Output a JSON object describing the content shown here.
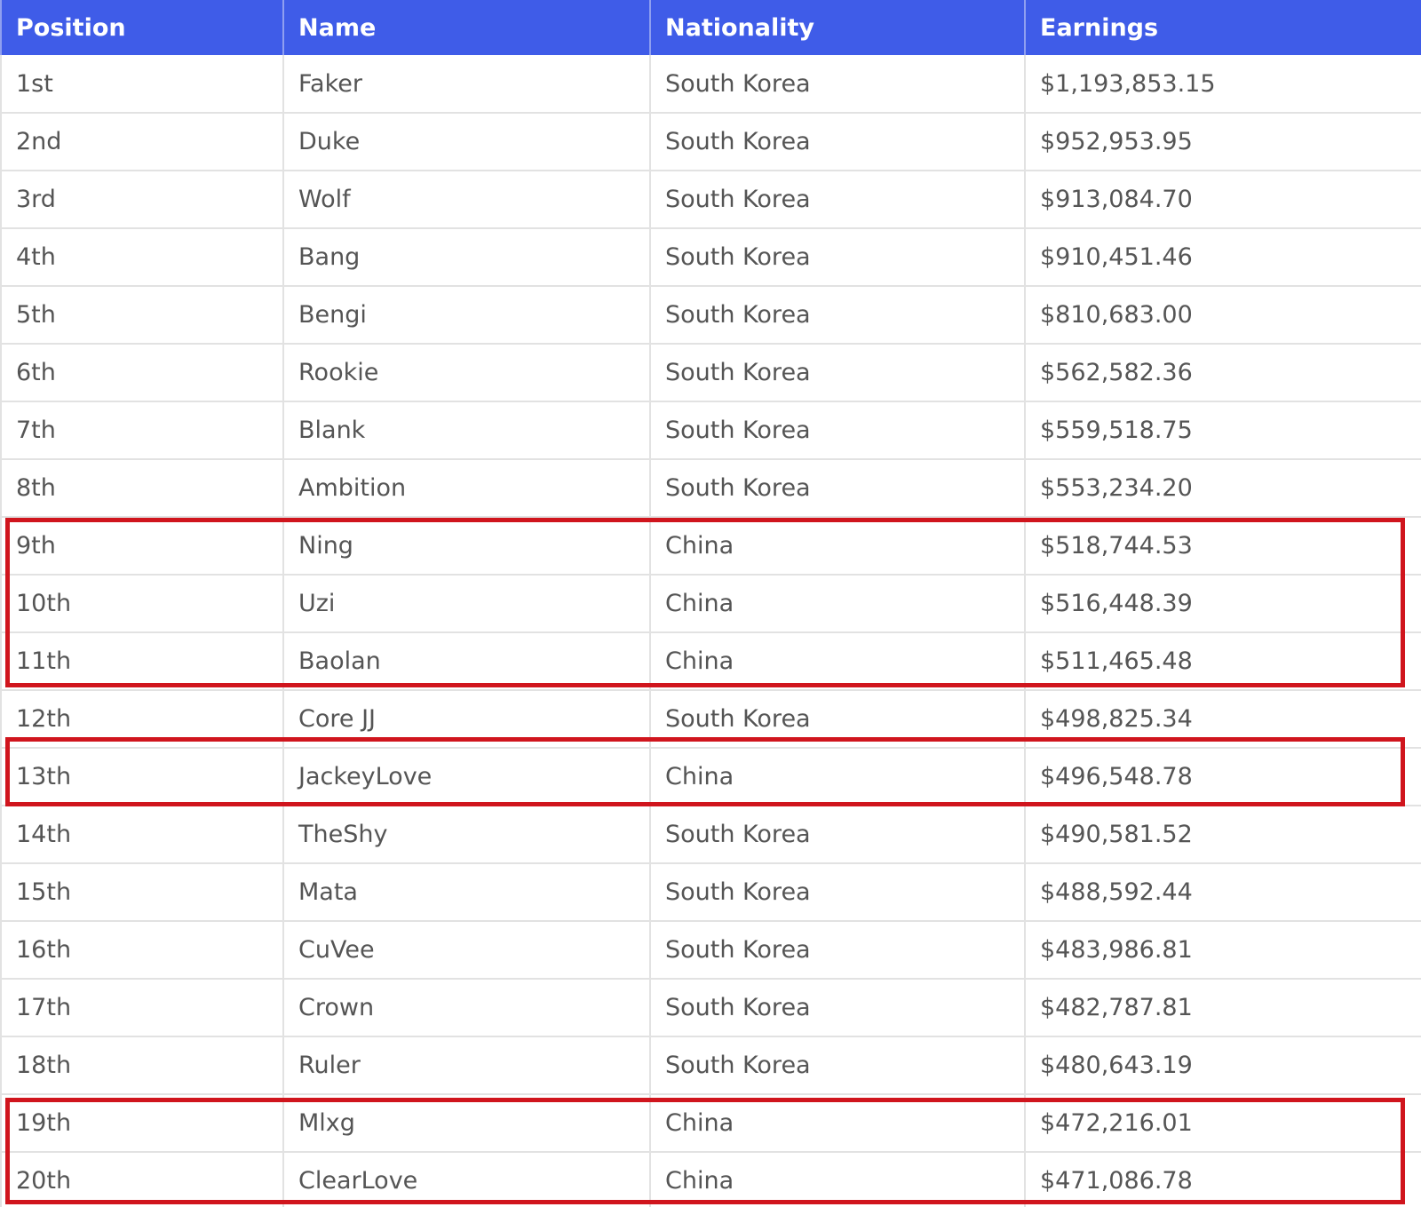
{
  "table": {
    "headers": [
      "Position",
      "Name",
      "Nationality",
      "Earnings"
    ],
    "rows": [
      {
        "position": "1st",
        "name": "Faker",
        "nationality": "South Korea",
        "earnings": "$1,193,853.15"
      },
      {
        "position": "2nd",
        "name": "Duke",
        "nationality": "South Korea",
        "earnings": "$952,953.95"
      },
      {
        "position": "3rd",
        "name": "Wolf",
        "nationality": "South Korea",
        "earnings": "$913,084.70"
      },
      {
        "position": "4th",
        "name": "Bang",
        "nationality": "South Korea",
        "earnings": "$910,451.46"
      },
      {
        "position": "5th",
        "name": "Bengi",
        "nationality": "South Korea",
        "earnings": "$810,683.00"
      },
      {
        "position": "6th",
        "name": "Rookie",
        "nationality": "South Korea",
        "earnings": "$562,582.36"
      },
      {
        "position": "7th",
        "name": "Blank",
        "nationality": "South Korea",
        "earnings": "$559,518.75"
      },
      {
        "position": "8th",
        "name": "Ambition",
        "nationality": "South Korea",
        "earnings": "$553,234.20"
      },
      {
        "position": "9th",
        "name": "Ning",
        "nationality": "China",
        "earnings": "$518,744.53"
      },
      {
        "position": "10th",
        "name": "Uzi",
        "nationality": "China",
        "earnings": "$516,448.39"
      },
      {
        "position": "11th",
        "name": "Baolan",
        "nationality": "China",
        "earnings": "$511,465.48"
      },
      {
        "position": "12th",
        "name": "Core JJ",
        "nationality": "South Korea",
        "earnings": "$498,825.34"
      },
      {
        "position": "13th",
        "name": "JackeyLove",
        "nationality": "China",
        "earnings": "$496,548.78"
      },
      {
        "position": "14th",
        "name": "TheShy",
        "nationality": "South Korea",
        "earnings": "$490,581.52"
      },
      {
        "position": "15th",
        "name": "Mata",
        "nationality": "South Korea",
        "earnings": "$488,592.44"
      },
      {
        "position": "16th",
        "name": "CuVee",
        "nationality": "South Korea",
        "earnings": "$483,986.81"
      },
      {
        "position": "17th",
        "name": "Crown",
        "nationality": "South Korea",
        "earnings": "$482,787.81"
      },
      {
        "position": "18th",
        "name": "Ruler",
        "nationality": "South Korea",
        "earnings": "$480,643.19"
      },
      {
        "position": "19th",
        "name": "Mlxg",
        "nationality": "China",
        "earnings": "$472,216.01"
      },
      {
        "position": "20th",
        "name": "ClearLove",
        "nationality": "China",
        "earnings": "$471,086.78"
      }
    ]
  },
  "highlights": {
    "color": "#d0151d",
    "groups": [
      [
        "9th",
        "10th",
        "11th"
      ],
      [
        "13th"
      ],
      [
        "19th",
        "20th"
      ]
    ]
  },
  "colors": {
    "header_background": "#3f5ce8",
    "header_text": "#ffffff",
    "cell_text": "#555555",
    "grid": "#e2e2e2"
  }
}
